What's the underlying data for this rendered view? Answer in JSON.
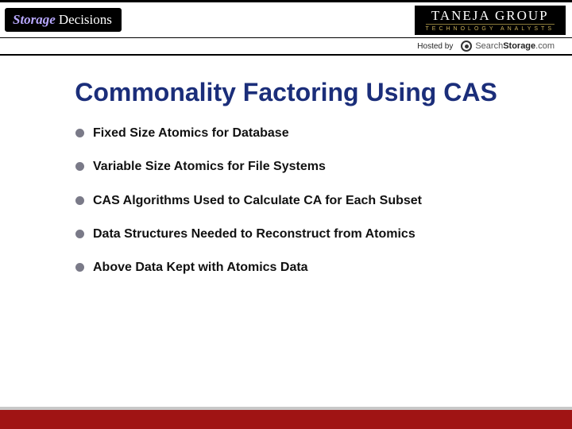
{
  "header": {
    "badge": {
      "word1": "Storage",
      "word2": "Decisions"
    },
    "taneja": {
      "line1": "TANEJA GROUP",
      "line2": "TECHNOLOGY ANALYSTS"
    }
  },
  "hosted": {
    "label": "Hosted by",
    "search": {
      "thin": "Search",
      "bold": "Storage",
      "dom": ".com"
    }
  },
  "title": "Commonality Factoring Using CAS",
  "bullets": [
    "Fixed Size Atomics for Database",
    "Variable Size Atomics for File Systems",
    "CAS Algorithms Used to Calculate CA for Each Subset",
    "Data Structures Needed to Reconstruct from Atomics",
    "Above Data Kept with Atomics Data"
  ]
}
